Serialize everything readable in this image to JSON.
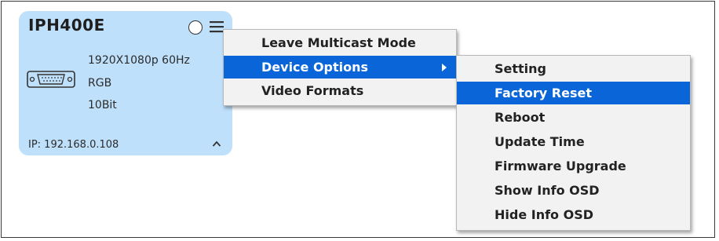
{
  "device": {
    "name": "IPH400E",
    "resolution": "1920X1080p 60Hz",
    "color_format": "RGB",
    "bit_depth": "10Bit",
    "ip": "IP: 192.168.0.108",
    "card_color": "#bfe0fb"
  },
  "context_menu": {
    "items": [
      {
        "label": "Leave Multicast Mode"
      },
      {
        "label": "Device Options"
      },
      {
        "label": "Video Formats"
      }
    ],
    "selected": "Device Options"
  },
  "submenu": {
    "items": [
      {
        "label": "Setting"
      },
      {
        "label": "Factory Reset"
      },
      {
        "label": "Reboot"
      },
      {
        "label": "Update Time"
      },
      {
        "label": "Firmware Upgrade"
      },
      {
        "label": "Show Info OSD"
      },
      {
        "label": "Hide Info OSD"
      }
    ],
    "selected": "Factory Reset"
  },
  "colors": {
    "highlight": "#0a66d8",
    "menu_bg": "#f2f2f2"
  },
  "icons": [
    "status-circle-icon",
    "hamburger-menu-icon",
    "vga-port-icon",
    "chevron-up-icon",
    "submenu-arrow-icon"
  ]
}
